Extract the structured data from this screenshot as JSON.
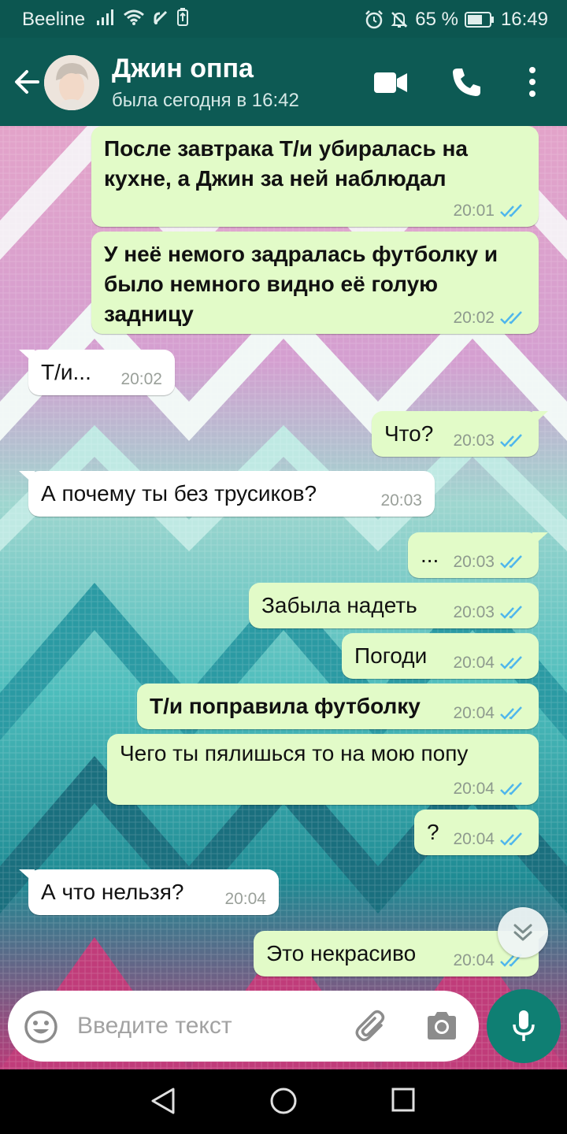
{
  "status_bar": {
    "carrier": "Beeline",
    "battery": "65 %",
    "time": "16:49",
    "icons": [
      "signal-icon",
      "wifi-icon",
      "nfc-icon",
      "battery-saver-icon",
      "alarm-icon",
      "mute-icon",
      "battery-icon"
    ]
  },
  "header": {
    "name": "Джин оппа",
    "status": "была сегодня в 16:42",
    "icons": [
      "back-arrow-icon",
      "video-call-icon",
      "phone-icon",
      "more-vert-icon"
    ]
  },
  "messages": [
    {
      "dir": "out",
      "text": "После завтрака Т/и убиралась на кухне, а Джин за ней наблюдал",
      "time": "20:01",
      "bold": true
    },
    {
      "dir": "out",
      "text": "У неё немого задралась футболку и было немного видно её голую задницу",
      "time": "20:02",
      "bold": true
    },
    {
      "dir": "in",
      "text": "Т/и...",
      "time": "20:02",
      "bold": false
    },
    {
      "dir": "out",
      "text": "Что?",
      "time": "20:03",
      "bold": false
    },
    {
      "dir": "in",
      "text": "А почему ты без трусиков?",
      "time": "20:03",
      "bold": false
    },
    {
      "dir": "out",
      "text": "...",
      "time": "20:03",
      "bold": false
    },
    {
      "dir": "out",
      "text": "Забыла надеть",
      "time": "20:03",
      "bold": false
    },
    {
      "dir": "out",
      "text": "Погоди",
      "time": "20:04",
      "bold": false
    },
    {
      "dir": "out",
      "text": "Т/и поправила футболку",
      "time": "20:04",
      "bold": true
    },
    {
      "dir": "out",
      "text": "Чего ты пялишься то на мою попу",
      "time": "20:04",
      "bold": false
    },
    {
      "dir": "out",
      "text": "?",
      "time": "20:04",
      "bold": false
    },
    {
      "dir": "in",
      "text": "А что нельзя?",
      "time": "20:04",
      "bold": false
    },
    {
      "dir": "out",
      "text": "Это некрасиво",
      "time": "20:04",
      "bold": false
    }
  ],
  "input": {
    "placeholder": "Введите текст",
    "icons": [
      "emoji-icon",
      "attach-icon",
      "camera-icon",
      "mic-icon"
    ]
  },
  "colors": {
    "header": "#0d5a54",
    "outgoing_bubble": "#e2fbc8",
    "incoming_bubble": "#ffffff",
    "read_ticks": "#4fb6ec",
    "mic_button": "#0f7f73"
  }
}
